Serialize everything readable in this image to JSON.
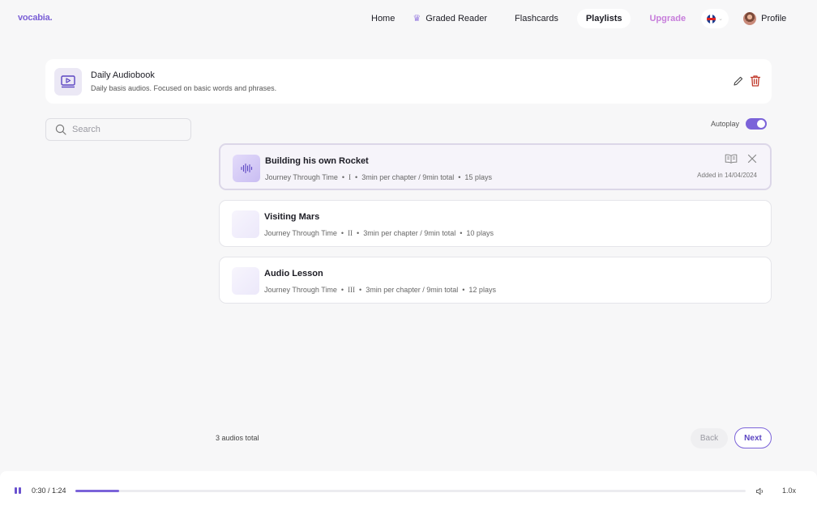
{
  "app": {
    "logo": "vocabia."
  },
  "nav": {
    "items": [
      {
        "label": "Home"
      },
      {
        "label": "Graded Reader"
      },
      {
        "label": "Flashcards"
      },
      {
        "label": "Playlists"
      },
      {
        "label": "Upgrade"
      }
    ],
    "active": "Playlists",
    "profile_label": "Profile"
  },
  "playlist": {
    "title": "Daily Audiobook",
    "description": "Daily basis audios. Focused on basic words and phrases."
  },
  "search": {
    "placeholder": "Search"
  },
  "autoplay": {
    "label": "Autoplay",
    "enabled": true
  },
  "tracks": [
    {
      "title": "Building his own Rocket",
      "series": "Journey Through Time",
      "chapter": "I",
      "duration": "3min per chapter / 9min total",
      "plays": "15 plays",
      "added": "Added in 14/04/2024"
    },
    {
      "title": "Visiting Mars",
      "series": "Journey Through Time",
      "chapter": "II",
      "duration": "3min per chapter / 9min total",
      "plays": "10 plays"
    },
    {
      "title": "Audio Lesson",
      "series": "Journey Through Time",
      "chapter": "III",
      "duration": "3min per chapter / 9min total",
      "plays": "12 plays"
    }
  ],
  "footer": {
    "total": "3 audios total",
    "back": "Back",
    "next": "Next"
  },
  "player": {
    "time": "0:30 / 1:24",
    "progress": 0.065,
    "speed": "1.0x"
  },
  "colors": {
    "accent": "#7b63d9",
    "upgrade": "#c77ddb",
    "delete": "#c0392b"
  }
}
